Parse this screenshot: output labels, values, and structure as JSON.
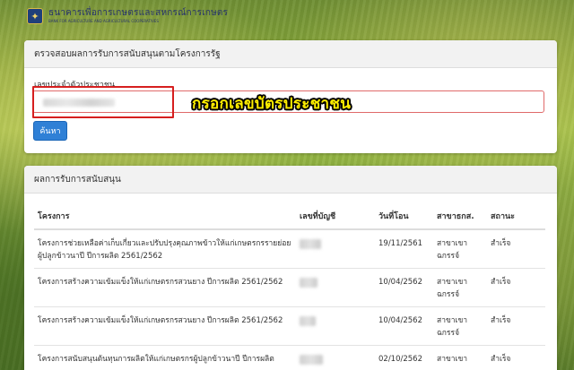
{
  "header": {
    "brand_th": "ธนาคารเพื่อการเกษตรและสหกรณ์การเกษตร",
    "brand_en": "BANK FOR AGRICULTURE AND AGRICULTURAL COOPERATIVES",
    "logo_icon": "baac-logo-icon"
  },
  "search": {
    "heading": "ตรวจสอบผลการรับการสนับสนุนตามโครงการรัฐ",
    "field_label": "เลขประจำตัวประชาชน",
    "field_value": "",
    "button_label": "ค้นหา",
    "annotation": "กรอกเลขบัตรประชาชน",
    "annotation_color": "#ffee00",
    "highlight_color": "#d61f1f",
    "button_color": "#2f80d6"
  },
  "results": {
    "heading": "ผลการรับการสนับสนุน",
    "columns": [
      "โครงการ",
      "เลขที่บัญชี",
      "วันที่โอน",
      "สาขาธกส.",
      "สถานะ"
    ],
    "rows": [
      {
        "project": "โครงการช่วยเหลือค่าเก็บเกี่ยวและปรับปรุงคุณภาพข้าวให้แก่เกษตรกรรายย่อยผู้ปลูกข้าวนาปี ปีการผลิต 2561/2562",
        "date": "19/11/2561",
        "branch": "สาขาเขาฉกรรจ์",
        "status": "สำเร็จ"
      },
      {
        "project": "โครงการสร้างความเข้มแข็งให้แก่เกษตรกรสวนยาง ปีการผลิต 2561/2562",
        "date": "10/04/2562",
        "branch": "สาขาเขาฉกรรจ์",
        "status": "สำเร็จ"
      },
      {
        "project": "โครงการสร้างความเข้มแข็งให้แก่เกษตรกรสวนยาง ปีการผลิต 2561/2562",
        "date": "10/04/2562",
        "branch": "สาขาเขาฉกรรจ์",
        "status": "สำเร็จ"
      },
      {
        "project": "โครงการสนับสนุนต้นทุนการผลิตให้แก่เกษตรกรผู้ปลูกข้าวนาปี ปีการผลิต",
        "date": "02/10/2562",
        "branch": "สาขาเขา",
        "status": "สำเร็จ"
      }
    ]
  }
}
